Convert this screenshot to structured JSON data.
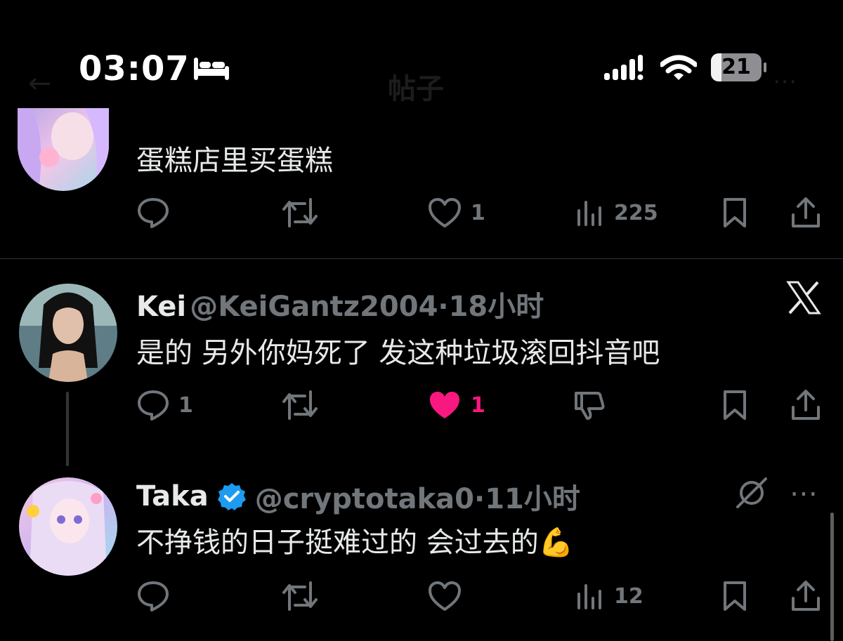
{
  "status_bar": {
    "time": "03:07",
    "battery": "21",
    "battery_level": 0.21
  },
  "ghost_header": {
    "title": "帖子"
  },
  "tweets": [
    {
      "text": "蛋糕店里买蛋糕",
      "actions": {
        "reply": "",
        "retweet": "",
        "like": "1",
        "views": "225"
      }
    },
    {
      "name": "Kei",
      "handle": "@KeiGantz2004",
      "time": "·18小时",
      "text": "是的 另外你妈死了 发这种垃圾滚回抖音吧",
      "actions": {
        "reply": "1",
        "retweet": "",
        "like": "1"
      },
      "like_color": "#f91880"
    },
    {
      "name": "Taka",
      "handle": "@cryptotaka0",
      "time": "·11小时",
      "text": "不挣钱的日子挺难过的 会过去的💪",
      "actions": {
        "reply": "",
        "retweet": "",
        "like": "",
        "views": "12"
      },
      "verified_color": "#1d9bf0"
    }
  ]
}
